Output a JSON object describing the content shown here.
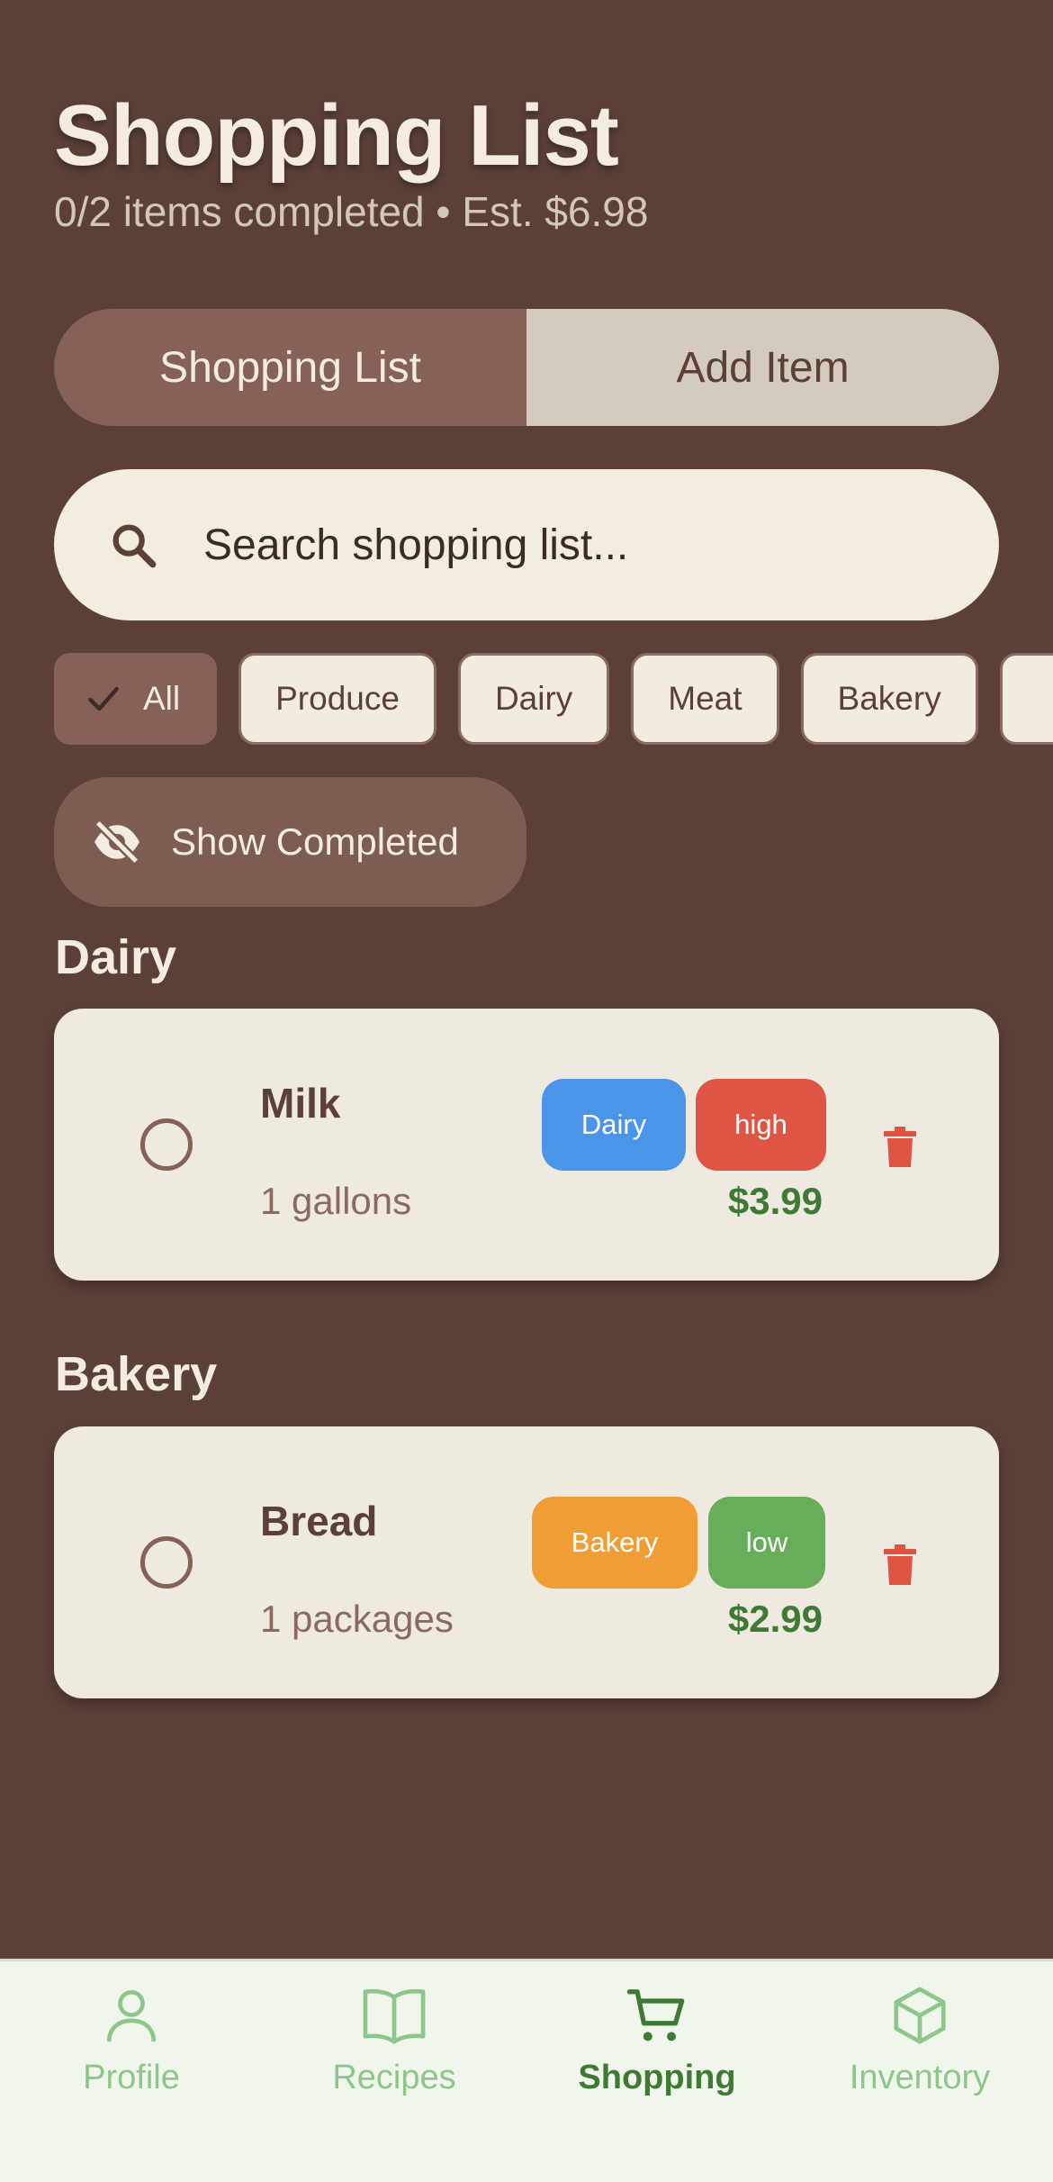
{
  "header": {
    "title": "Shopping List",
    "subtitle": "0/2 items completed • Est. $6.98"
  },
  "tabs": [
    {
      "label": "Shopping List",
      "active": true
    },
    {
      "label": "Add Item",
      "active": false
    }
  ],
  "search": {
    "placeholder": "Search shopping list...",
    "icon": "search-icon"
  },
  "filters": [
    {
      "label": "All",
      "selected": true
    },
    {
      "label": "Produce",
      "selected": false
    },
    {
      "label": "Dairy",
      "selected": false
    },
    {
      "label": "Meat",
      "selected": false
    },
    {
      "label": "Bakery",
      "selected": false
    }
  ],
  "toggle": {
    "label": "Show Completed",
    "icon": "eye-off-icon"
  },
  "sections": [
    {
      "title": "Dairy",
      "items": [
        {
          "name": "Milk",
          "quantity": "1 gallons",
          "category": "Dairy",
          "category_color": "#4a95e8",
          "priority": "high",
          "priority_color": "#e05444",
          "price": "$3.99",
          "completed": false
        }
      ]
    },
    {
      "title": "Bakery",
      "items": [
        {
          "name": "Bread",
          "quantity": "1 packages",
          "category": "Bakery",
          "category_color": "#f09d36",
          "priority": "low",
          "priority_color": "#68ad5a",
          "price": "$2.99",
          "completed": false
        }
      ]
    }
  ],
  "bottom_nav": [
    {
      "label": "Profile",
      "icon": "person-icon",
      "active": false
    },
    {
      "label": "Recipes",
      "icon": "book-icon",
      "active": false
    },
    {
      "label": "Shopping",
      "icon": "cart-icon",
      "active": true
    },
    {
      "label": "Inventory",
      "icon": "cube-icon",
      "active": false
    }
  ],
  "colors": {
    "background": "#5c4038",
    "accent_green": "#3f7a34",
    "delete_red": "#e05444"
  }
}
